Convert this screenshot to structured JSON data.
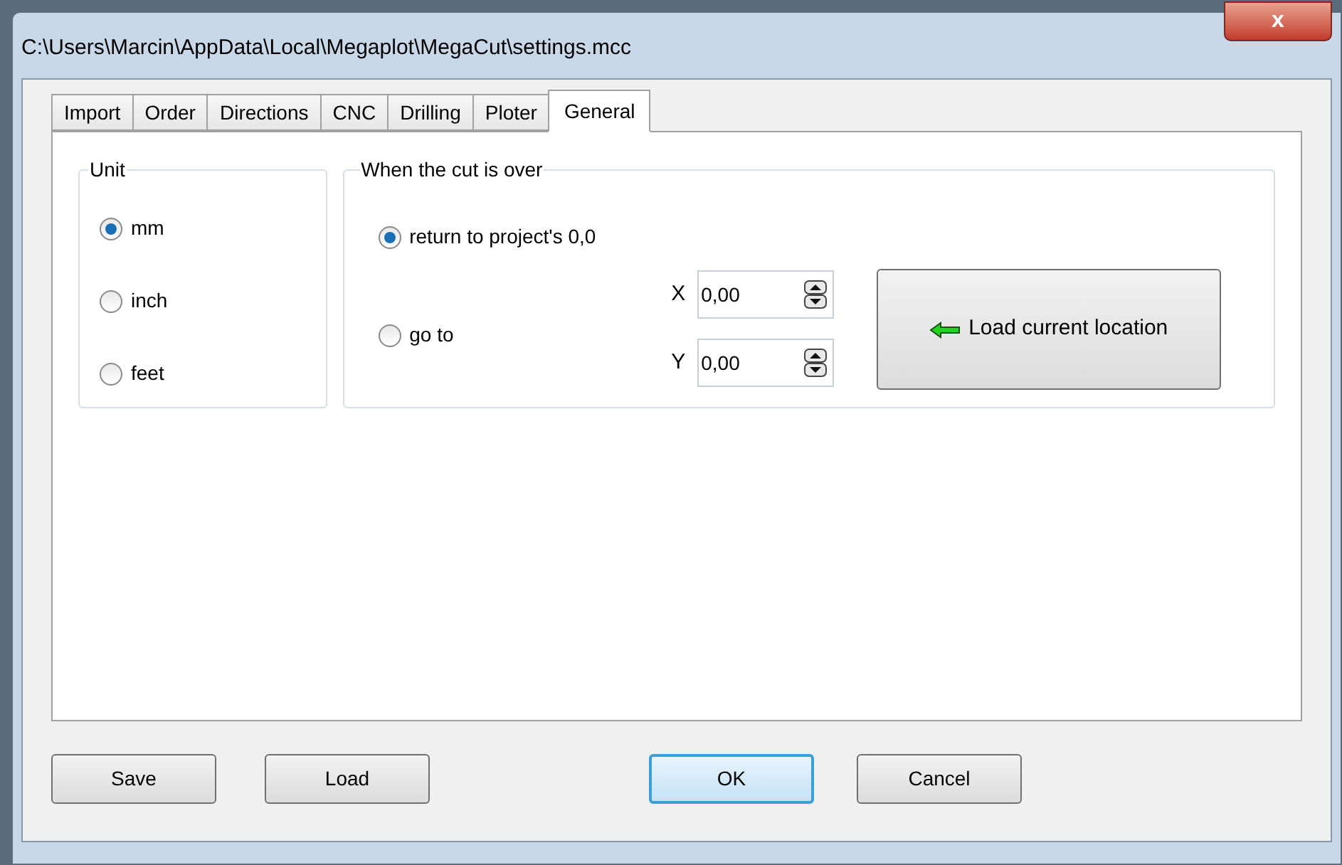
{
  "window": {
    "title": "C:\\Users\\Marcin\\AppData\\Local\\Megaplot\\MegaCut\\settings.mcc",
    "close": "x"
  },
  "tabs": [
    {
      "label": "Import",
      "selected": false
    },
    {
      "label": "Order",
      "selected": false
    },
    {
      "label": "Directions",
      "selected": false
    },
    {
      "label": "CNC",
      "selected": false
    },
    {
      "label": "Drilling",
      "selected": false
    },
    {
      "label": "Ploter",
      "selected": false
    },
    {
      "label": "General",
      "selected": true
    }
  ],
  "unit": {
    "title": "Unit",
    "options": [
      {
        "label": "mm",
        "selected": true
      },
      {
        "label": "inch",
        "selected": false
      },
      {
        "label": "feet",
        "selected": false
      }
    ]
  },
  "cut_over": {
    "title": "When the cut is over",
    "options": [
      {
        "label": "return to project's 0,0",
        "selected": true
      },
      {
        "label": "go to",
        "selected": false
      }
    ],
    "fields": [
      {
        "label": "X",
        "value": "0,00"
      },
      {
        "label": "Y",
        "value": "0,00"
      }
    ],
    "load_button": "Load current location"
  },
  "buttons": [
    {
      "label": "Save",
      "default": false
    },
    {
      "label": "Load",
      "default": false
    },
    {
      "label": "OK",
      "default": true
    },
    {
      "label": "Cancel",
      "default": false
    }
  ]
}
